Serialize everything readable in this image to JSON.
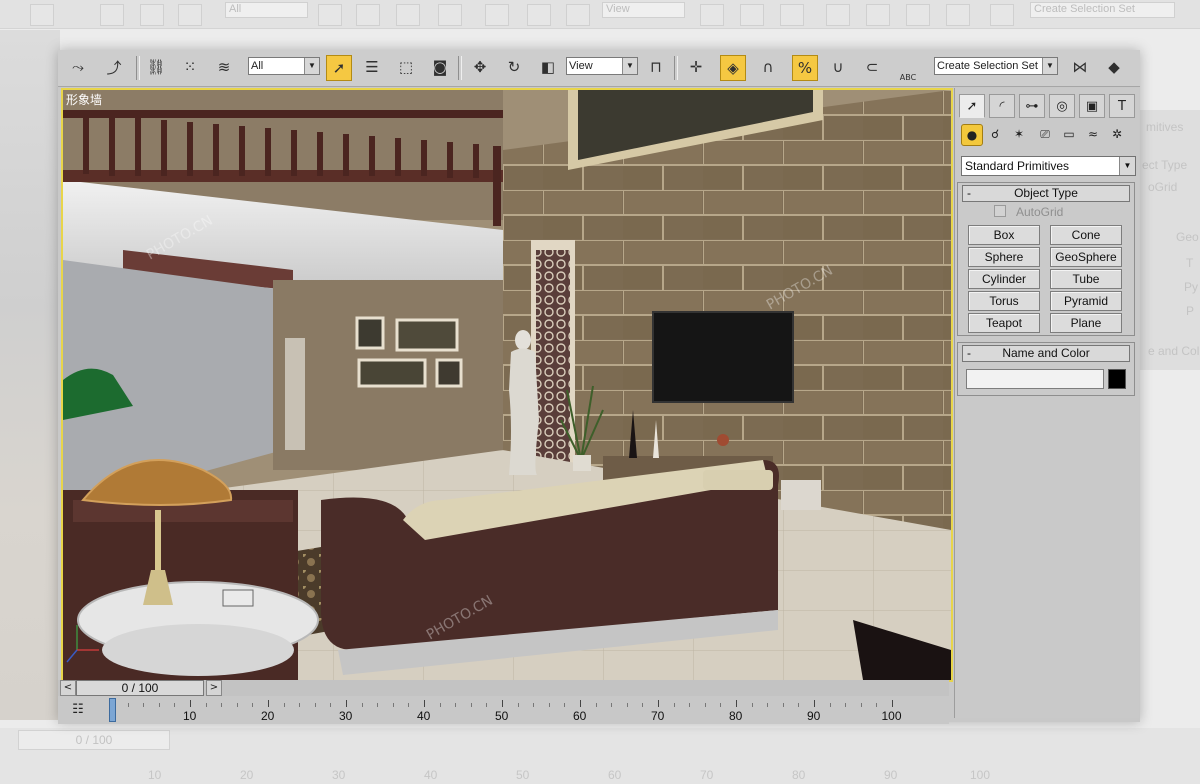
{
  "viewport": {
    "label": "形象墙"
  },
  "toolbar": {
    "selection_filter": "All",
    "ref_coord": "View",
    "named_selection": "Create Selection Set",
    "abc_label": "ABC"
  },
  "background": {
    "toolbar_filter": "All",
    "toolbar_view": "View",
    "toolbar_selection": "Create Selection Set",
    "panel_texts": [
      "mitives",
      "ect Type",
      "oGrid",
      "Geo",
      "T",
      "Py",
      "P",
      "e and Col"
    ],
    "time_display": "0 / 100",
    "ticks": [
      "10",
      "20",
      "30",
      "40",
      "50",
      "60",
      "70",
      "80",
      "90",
      "100"
    ]
  },
  "command_panel": {
    "category": "Standard Primitives",
    "object_type_title": "Object Type",
    "autogrid_label": "AutoGrid",
    "buttons": [
      "Box",
      "Cone",
      "Sphere",
      "GeoSphere",
      "Cylinder",
      "Tube",
      "Torus",
      "Pyramid",
      "Teapot",
      "Plane"
    ],
    "name_color_title": "Name and Color",
    "object_name": "",
    "object_color": "#000000"
  },
  "timeline": {
    "time_display": "0 / 100",
    "current_frame": 0,
    "ticks": [
      "0",
      "10",
      "20",
      "30",
      "40",
      "50",
      "60",
      "70",
      "80",
      "90",
      "100"
    ]
  },
  "colors": {
    "active_accent": "#f5c842",
    "viewport_border": "#e8d54a"
  },
  "watermark": {
    "text": "PHOTO.CN"
  },
  "icons": [
    "select-icon",
    "select-link-icon",
    "unlink-icon",
    "bind-icon",
    "select-object-icon",
    "select-by-name-icon",
    "rect-region-icon",
    "window-crossing-icon",
    "move-icon",
    "rotate-icon",
    "scale-icon",
    "pivot-icon",
    "manipulate-icon",
    "snap-3d-icon",
    "angle-snap-icon",
    "percent-snap-icon",
    "spinner-snap-icon",
    "edit-named-sel-icon",
    "mirror-icon",
    "align-icon",
    "create-tab-icon",
    "modify-tab-icon",
    "hierarchy-tab-icon",
    "motion-tab-icon",
    "display-tab-icon",
    "utilities-tab-icon",
    "geometry-icon",
    "shapes-icon",
    "lights-icon",
    "cameras-icon",
    "helpers-icon",
    "spacewarps-icon",
    "systems-icon"
  ]
}
